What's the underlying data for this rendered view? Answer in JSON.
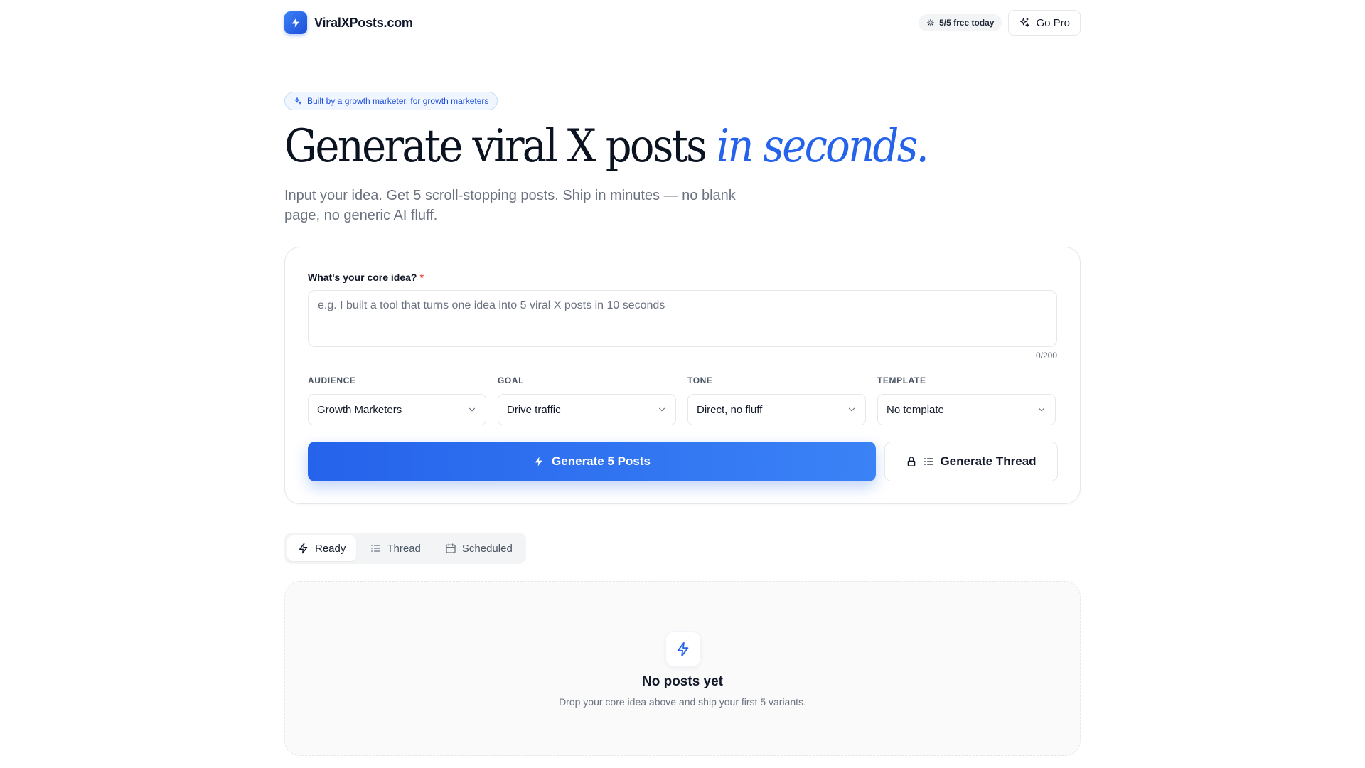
{
  "header": {
    "brand_name": "ViralXPosts.com",
    "quota_label": "5/5 free today",
    "gopro_label": "Go Pro"
  },
  "hero": {
    "badge": "Built by a growth marketer, for growth marketers",
    "title_main": "Generate viral X posts ",
    "title_accent": "in seconds.",
    "subtitle": "Input your idea. Get 5 scroll-stopping posts. Ship in minutes — no blank page, no generic AI fluff."
  },
  "form": {
    "idea_label": "What's your core idea?",
    "required_mark": "*",
    "idea_value": "",
    "idea_placeholder": "e.g. I built a tool that turns one idea into 5 viral X posts in 10 seconds",
    "char_count": "0/200",
    "selects": [
      {
        "label": "Audience",
        "value": "Growth Marketers"
      },
      {
        "label": "Goal",
        "value": "Drive traffic"
      },
      {
        "label": "Tone",
        "value": "Direct, no fluff"
      },
      {
        "label": "Template",
        "value": "No template"
      }
    ],
    "generate_label": "Generate 5 Posts",
    "thread_label": "Generate Thread"
  },
  "tabs": [
    {
      "label": "Ready",
      "active": true
    },
    {
      "label": "Thread",
      "active": false
    },
    {
      "label": "Scheduled",
      "active": false
    }
  ],
  "empty_state": {
    "title": "No posts yet",
    "subtitle": "Drop your core idea above and ship your first 5 variants."
  },
  "colors": {
    "accent": "#2563eb",
    "accent_light": "#3b82f6",
    "required": "#ef4444",
    "muted_text": "#6b7280"
  },
  "icons": {
    "brand": "bolt-icon",
    "quota": "sparkle-icon",
    "gopro": "sparkle-icon",
    "select": "chevron-down-icon",
    "generate": "bolt-icon",
    "thread_lock": "lock-icon",
    "thread_list": "list-icon",
    "tab_ready": "bolt-icon",
    "tab_thread": "list-icon",
    "tab_scheduled": "calendar-icon",
    "empty": "bolt-icon"
  }
}
